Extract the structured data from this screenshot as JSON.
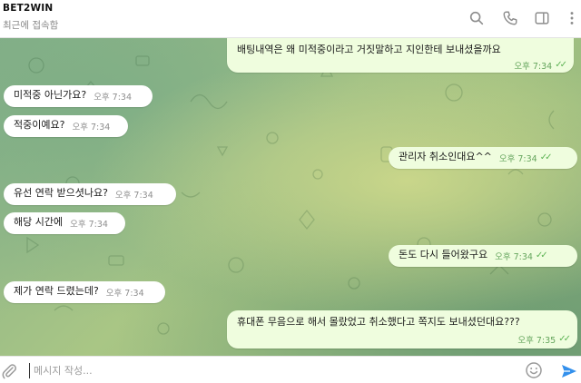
{
  "header": {
    "title": "BET2WIN",
    "status": "최근에 접속함"
  },
  "messages": [
    {
      "dir": "out",
      "text": "배팅내역은 왜 미적중이라고 거짓말하고 지인한테 보내셨을까요",
      "time": "오후 7:34",
      "read": true
    },
    {
      "dir": "in",
      "text": "미적중 아닌가요?",
      "time": "오후 7:34"
    },
    {
      "dir": "in",
      "text": "적중이예요?",
      "time": "오후 7:34"
    },
    {
      "dir": "out",
      "text": "관리자 취소인대요^^",
      "time": "오후 7:34",
      "read": true
    },
    {
      "dir": "in",
      "text": "유선 연락 받으셧나요?",
      "time": "오후 7:34"
    },
    {
      "dir": "in",
      "text": "해당 시간에",
      "time": "오후 7:34"
    },
    {
      "dir": "out",
      "text": "돈도 다시 들어왔구요",
      "time": "오후 7:34",
      "read": true
    },
    {
      "dir": "in",
      "text": "제가 연락 드렸는데?",
      "time": "오후 7:34"
    },
    {
      "dir": "out",
      "text": "휴대폰 무음으로 해서 몰랐었고 취소했다고 쪽지도 보내셨던대요???",
      "time": "오후 7:35",
      "read": true
    }
  ],
  "composer": {
    "placeholder": "메시지 작성..."
  },
  "colors": {
    "outgoing_bubble": "#effdde",
    "incoming_bubble": "#ffffff",
    "read_check": "#5fb456",
    "send_icon": "#3390ec"
  },
  "icons": [
    "search-icon",
    "phone-icon",
    "sidebar-toggle-icon",
    "more-icon",
    "attach-icon",
    "emoji-icon",
    "send-icon"
  ]
}
